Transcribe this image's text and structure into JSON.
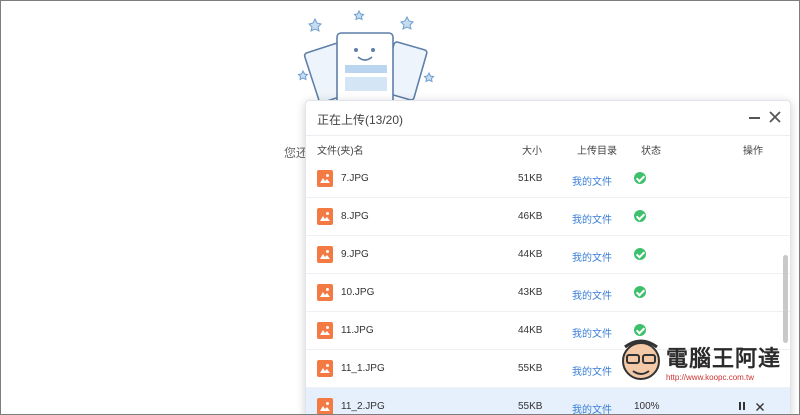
{
  "background": {
    "empty_text": "您还"
  },
  "upload_panel": {
    "title": "正在上传(13/20)",
    "columns": {
      "name": "文件(夹)名",
      "size": "大小",
      "dir": "上传目录",
      "status": "状态",
      "action": "操作"
    },
    "rows": [
      {
        "name": "7.JPG",
        "size": "51KB",
        "dir": "我的文件",
        "status": "done"
      },
      {
        "name": "8.JPG",
        "size": "46KB",
        "dir": "我的文件",
        "status": "done"
      },
      {
        "name": "9.JPG",
        "size": "44KB",
        "dir": "我的文件",
        "status": "done"
      },
      {
        "name": "10.JPG",
        "size": "43KB",
        "dir": "我的文件",
        "status": "done"
      },
      {
        "name": "11.JPG",
        "size": "44KB",
        "dir": "我的文件",
        "status": "done"
      },
      {
        "name": "11_1.JPG",
        "size": "55KB",
        "dir": "我的文件",
        "status": "done"
      },
      {
        "name": "11_2.JPG",
        "size": "55KB",
        "dir": "我的文件",
        "status_text": "100%"
      }
    ]
  },
  "watermark": {
    "text": "電腦王阿達",
    "url": "http://www.koopc.com.tw"
  },
  "colors": {
    "file_icon": "#f47a44",
    "success": "#3dc06c",
    "link": "#3b7fd6",
    "active_row": "#e6f0fc"
  },
  "icons": {
    "file_type": "image-file-icon",
    "status_done": "check-circle-icon",
    "minimize": "minimize-icon",
    "close": "close-icon",
    "pause": "pause-icon",
    "cancel": "cancel-icon"
  }
}
